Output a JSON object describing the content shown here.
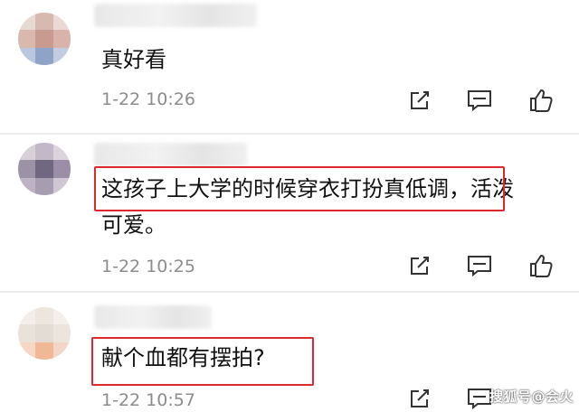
{
  "comments": [
    {
      "text_lines": [
        "真好看"
      ],
      "timestamp": "1-22 10:26"
    },
    {
      "text_lines": [
        "这孩子上大学的时候穿衣打扮真低调，活泼",
        "可爱。"
      ],
      "highlighted_phrase": "这孩子上大学的时候穿衣打扮真低调，",
      "timestamp": "1-22 10:25"
    },
    {
      "text_lines": [
        "献个血都有摆拍?"
      ],
      "highlighted_phrase": "献个血都有摆拍?",
      "timestamp": "1-22 10:57"
    }
  ],
  "actions": {
    "share_icon": "share-edit-icon",
    "comment_icon": "comment-bubble-icon",
    "like_icon": "thumbs-up-icon"
  },
  "colors": {
    "highlight_border": "#e0262e",
    "timestamp": "#8c8c8c",
    "icon": "#333333"
  },
  "watermark": "搜狐号@会火"
}
